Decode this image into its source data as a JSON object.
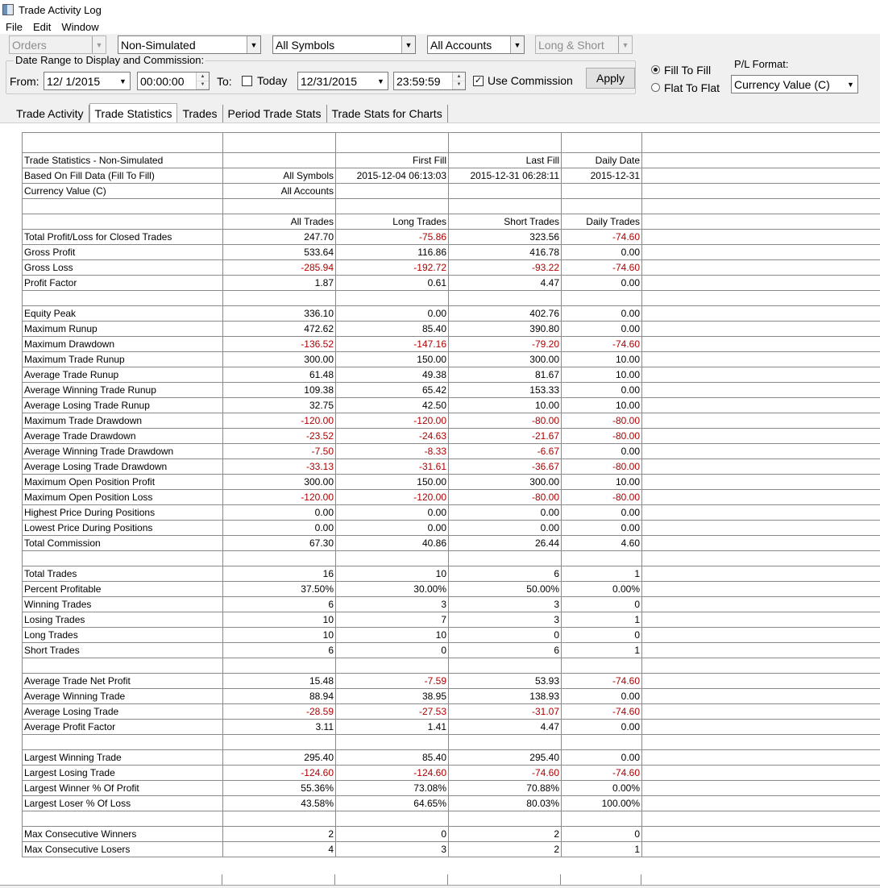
{
  "window": {
    "title": "Trade Activity Log"
  },
  "menu": [
    "File",
    "Edit",
    "Window"
  ],
  "toolbar": {
    "orders": "Orders",
    "simulation": "Non-Simulated",
    "symbols": "All Symbols",
    "accounts": "All Accounts",
    "direction": "Long & Short"
  },
  "date_range": {
    "group_label": "Date Range to Display and Commission:",
    "from_label": "From:",
    "from_date": "12/ 1/2015",
    "from_time": "00:00:00",
    "to_label": "To:",
    "today_label": "Today",
    "today_checked": false,
    "to_date": "12/31/2015",
    "to_time": "23:59:59",
    "commission_label": "Use Commission",
    "commission_checked": true,
    "apply_label": "Apply"
  },
  "fill_mode": {
    "options": [
      "Fill To Fill",
      "Flat To Flat"
    ],
    "selected": "Fill To Fill"
  },
  "pl_format": {
    "label": "P/L Format:",
    "value": "Currency Value (C)"
  },
  "tabs": [
    "Trade Activity",
    "Trade Statistics",
    "Trades",
    "Period Trade Stats",
    "Trade Stats for Charts"
  ],
  "active_tab": "Trade Statistics",
  "stats_rows": [
    [
      "",
      "",
      "",
      "",
      ""
    ],
    [
      "Trade Statistics - Non-Simulated",
      "",
      "First Fill",
      "Last Fill",
      "Daily Date"
    ],
    [
      "Based On Fill Data (Fill To Fill)",
      "All Symbols",
      "2015-12-04  06:13:03",
      "2015-12-31  06:28:11",
      "2015-12-31"
    ],
    [
      "Currency Value (C)",
      "All Accounts",
      "",
      "",
      ""
    ],
    [
      "",
      "",
      "",
      "",
      ""
    ],
    [
      "",
      "All Trades",
      "Long Trades",
      "Short Trades",
      "Daily Trades"
    ],
    [
      "Total Profit/Loss for Closed Trades",
      "247.70",
      "-75.86",
      "323.56",
      "-74.60"
    ],
    [
      "Gross Profit",
      "533.64",
      "116.86",
      "416.78",
      "0.00"
    ],
    [
      "Gross Loss",
      "-285.94",
      "-192.72",
      "-93.22",
      "-74.60"
    ],
    [
      "Profit Factor",
      "1.87",
      "0.61",
      "4.47",
      "0.00"
    ],
    [
      "",
      "",
      "",
      "",
      ""
    ],
    [
      "Equity Peak",
      "336.10",
      "0.00",
      "402.76",
      "0.00"
    ],
    [
      "Maximum Runup",
      "472.62",
      "85.40",
      "390.80",
      "0.00"
    ],
    [
      "Maximum Drawdown",
      "-136.52",
      "-147.16",
      "-79.20",
      "-74.60"
    ],
    [
      "Maximum Trade Runup",
      "300.00",
      "150.00",
      "300.00",
      "10.00"
    ],
    [
      "Average Trade Runup",
      "61.48",
      "49.38",
      "81.67",
      "10.00"
    ],
    [
      "Average Winning Trade Runup",
      "109.38",
      "65.42",
      "153.33",
      "0.00"
    ],
    [
      "Average Losing Trade Runup",
      "32.75",
      "42.50",
      "10.00",
      "10.00"
    ],
    [
      "Maximum Trade Drawdown",
      "-120.00",
      "-120.00",
      "-80.00",
      "-80.00"
    ],
    [
      "Average Trade Drawdown",
      "-23.52",
      "-24.63",
      "-21.67",
      "-80.00"
    ],
    [
      "Average Winning Trade Drawdown",
      "-7.50",
      "-8.33",
      "-6.67",
      "0.00"
    ],
    [
      "Average Losing Trade Drawdown",
      "-33.13",
      "-31.61",
      "-36.67",
      "-80.00"
    ],
    [
      "Maximum Open Position Profit",
      "300.00",
      "150.00",
      "300.00",
      "10.00"
    ],
    [
      "Maximum Open Position Loss",
      "-120.00",
      "-120.00",
      "-80.00",
      "-80.00"
    ],
    [
      "Highest Price During Positions",
      "0.00",
      "0.00",
      "0.00",
      "0.00"
    ],
    [
      "Lowest Price During Positions",
      "0.00",
      "0.00",
      "0.00",
      "0.00"
    ],
    [
      "Total Commission",
      "67.30",
      "40.86",
      "26.44",
      "4.60"
    ],
    [
      "",
      "",
      "",
      "",
      ""
    ],
    [
      "Total Trades",
      "16",
      "10",
      "6",
      "1"
    ],
    [
      "Percent Profitable",
      "37.50%",
      "30.00%",
      "50.00%",
      "0.00%"
    ],
    [
      "Winning Trades",
      "6",
      "3",
      "3",
      "0"
    ],
    [
      "Losing Trades",
      "10",
      "7",
      "3",
      "1"
    ],
    [
      "Long Trades",
      "10",
      "10",
      "0",
      "0"
    ],
    [
      "Short Trades",
      "6",
      "0",
      "6",
      "1"
    ],
    [
      "",
      "",
      "",
      "",
      ""
    ],
    [
      "Average Trade Net Profit",
      "15.48",
      "-7.59",
      "53.93",
      "-74.60"
    ],
    [
      "Average Winning Trade",
      "88.94",
      "38.95",
      "138.93",
      "0.00"
    ],
    [
      "Average Losing Trade",
      "-28.59",
      "-27.53",
      "-31.07",
      "-74.60"
    ],
    [
      "Average Profit Factor",
      "3.11",
      "1.41",
      "4.47",
      "0.00"
    ],
    [
      "",
      "",
      "",
      "",
      ""
    ],
    [
      "Largest Winning Trade",
      "295.40",
      "85.40",
      "295.40",
      "0.00"
    ],
    [
      "Largest Losing Trade",
      "-124.60",
      "-124.60",
      "-74.60",
      "-74.60"
    ],
    [
      "Largest Winner % Of Profit",
      "55.36%",
      "73.08%",
      "70.88%",
      "0.00%"
    ],
    [
      "Largest Loser % Of Loss",
      "43.58%",
      "64.65%",
      "80.03%",
      "100.00%"
    ],
    [
      "",
      "",
      "",
      "",
      ""
    ],
    [
      "Max Consecutive Winners",
      "2",
      "0",
      "2",
      "0"
    ],
    [
      "Max Consecutive Losers",
      "4",
      "3",
      "2",
      "1"
    ]
  ],
  "colors": {
    "negative": "#b00000",
    "grid_line": "#8a8a8a"
  }
}
